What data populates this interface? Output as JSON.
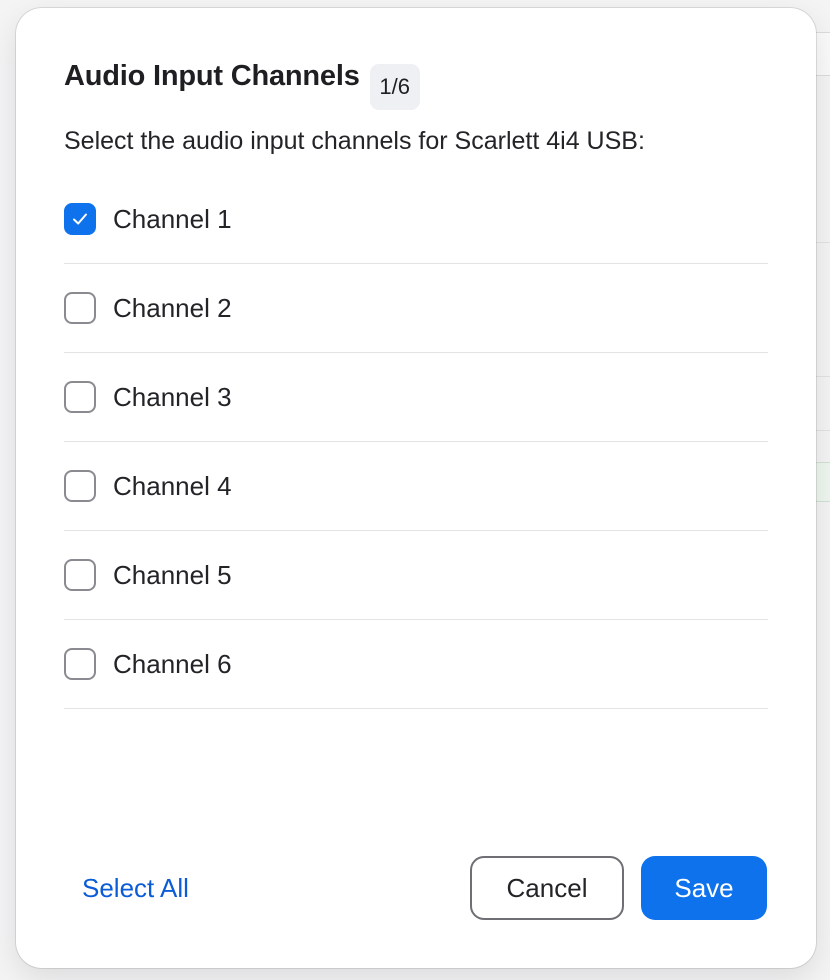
{
  "dialog": {
    "title": "Audio Input Channels",
    "selected_count": "1/6",
    "subtitle": "Select the audio input channels for Scarlett 4i4 USB:",
    "channels": [
      {
        "label": "Channel 1",
        "checked": true
      },
      {
        "label": "Channel 2",
        "checked": false
      },
      {
        "label": "Channel 3",
        "checked": false
      },
      {
        "label": "Channel 4",
        "checked": false
      },
      {
        "label": "Channel 5",
        "checked": false
      },
      {
        "label": "Channel 6",
        "checked": false
      }
    ],
    "select_all_label": "Select All",
    "cancel_label": "Cancel",
    "save_label": "Save"
  },
  "colors": {
    "accent": "#0e72ed",
    "link": "#0b5cd7",
    "text": "#232328",
    "divider": "#e4e4e7"
  },
  "icons": {
    "checkbox_checked": "checkmark-icon"
  }
}
